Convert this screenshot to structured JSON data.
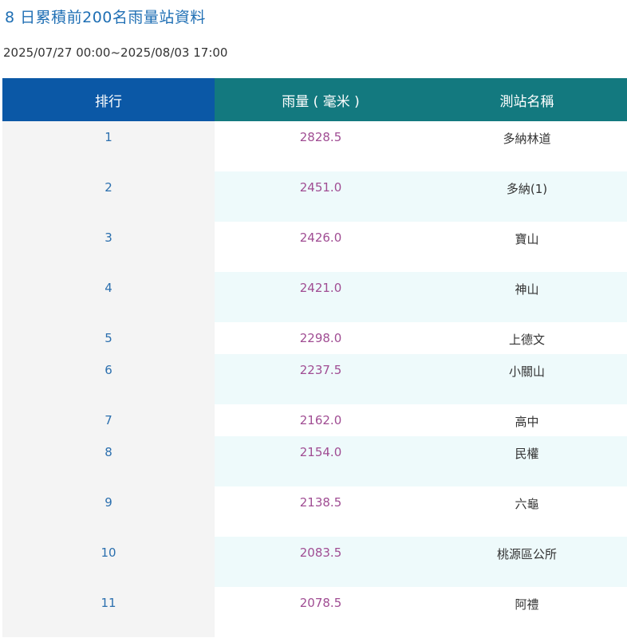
{
  "page": {
    "title": "8 日累積前200名雨量站資料",
    "period": "2025/07/27 00:00~2025/08/03 17:00"
  },
  "table": {
    "headers": {
      "rank": "排行",
      "rainfall": "雨量 ( 毫米 )",
      "station": "測站名稱"
    },
    "rows": [
      {
        "rank": "1",
        "rainfall": "2828.5",
        "station": "多納林道"
      },
      {
        "rank": "2",
        "rainfall": "2451.0",
        "station": "多納(1)"
      },
      {
        "rank": "3",
        "rainfall": "2426.0",
        "station": "寶山"
      },
      {
        "rank": "4",
        "rainfall": "2421.0",
        "station": "神山"
      },
      {
        "rank": "5",
        "rainfall": "2298.0",
        "station": "上德文"
      },
      {
        "rank": "6",
        "rainfall": "2237.5",
        "station": "小關山"
      },
      {
        "rank": "7",
        "rainfall": "2162.0",
        "station": "高中"
      },
      {
        "rank": "8",
        "rainfall": "2154.0",
        "station": "民權"
      },
      {
        "rank": "9",
        "rainfall": "2138.5",
        "station": "六龜"
      },
      {
        "rank": "10",
        "rainfall": "2083.5",
        "station": "桃源區公所"
      },
      {
        "rank": "11",
        "rainfall": "2078.5",
        "station": "阿禮"
      }
    ]
  },
  "colors": {
    "title": "#1f6fb4",
    "header_rank_bg": "#0b58a6",
    "header_bg": "#13797f",
    "rainfall_text": "#a04d93",
    "rank_text": "#2b6fae"
  }
}
